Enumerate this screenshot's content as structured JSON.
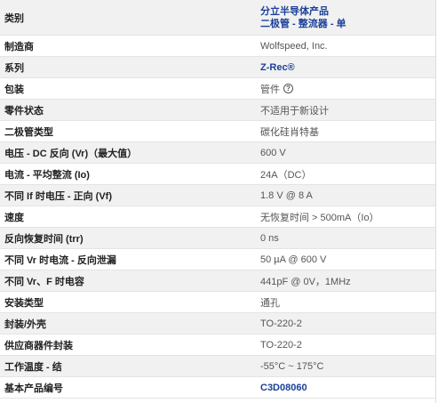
{
  "rows": [
    {
      "label": "类别",
      "values": [
        "分立半导体产品",
        "二极管 - 整流器 - 单"
      ]
    },
    {
      "label": "制造商",
      "value": "Wolfspeed, Inc."
    },
    {
      "label": "系列",
      "value": "Z-Rec®"
    },
    {
      "label": "包装",
      "value": "管件"
    },
    {
      "label": "零件状态",
      "value": "不适用于新设计"
    },
    {
      "label": "二极管类型",
      "value": "碳化硅肖特基"
    },
    {
      "label": "电压 - DC 反向 (Vr)（最大值）",
      "value": "600 V"
    },
    {
      "label": "电流 - 平均整流 (Io)",
      "value": "24A（DC）"
    },
    {
      "label": "不同 If 时电压 - 正向 (Vf)",
      "value": "1.8 V @ 8 A"
    },
    {
      "label": "速度",
      "value": "无恢复时间 > 500mA（Io）"
    },
    {
      "label": "反向恢复时间 (trr)",
      "value": "0 ns"
    },
    {
      "label": "不同 Vr 时电流 - 反向泄漏",
      "value": "50 µA @ 600 V"
    },
    {
      "label": "不同 Vr、F 时电容",
      "value": "441pF @ 0V，1MHz"
    },
    {
      "label": "安装类型",
      "value": "通孔"
    },
    {
      "label": "封装/外壳",
      "value": "TO-220-2"
    },
    {
      "label": "供应商器件封装",
      "value": "TO-220-2"
    },
    {
      "label": "工作温度 - 结",
      "value": "-55°C ~ 175°C"
    },
    {
      "label": "基本产品编号",
      "value": "C3D08060"
    }
  ],
  "help_icon": "help-circle-icon",
  "colors": {
    "link": "#1b3f99",
    "row_alt": "#f1f1f1"
  }
}
